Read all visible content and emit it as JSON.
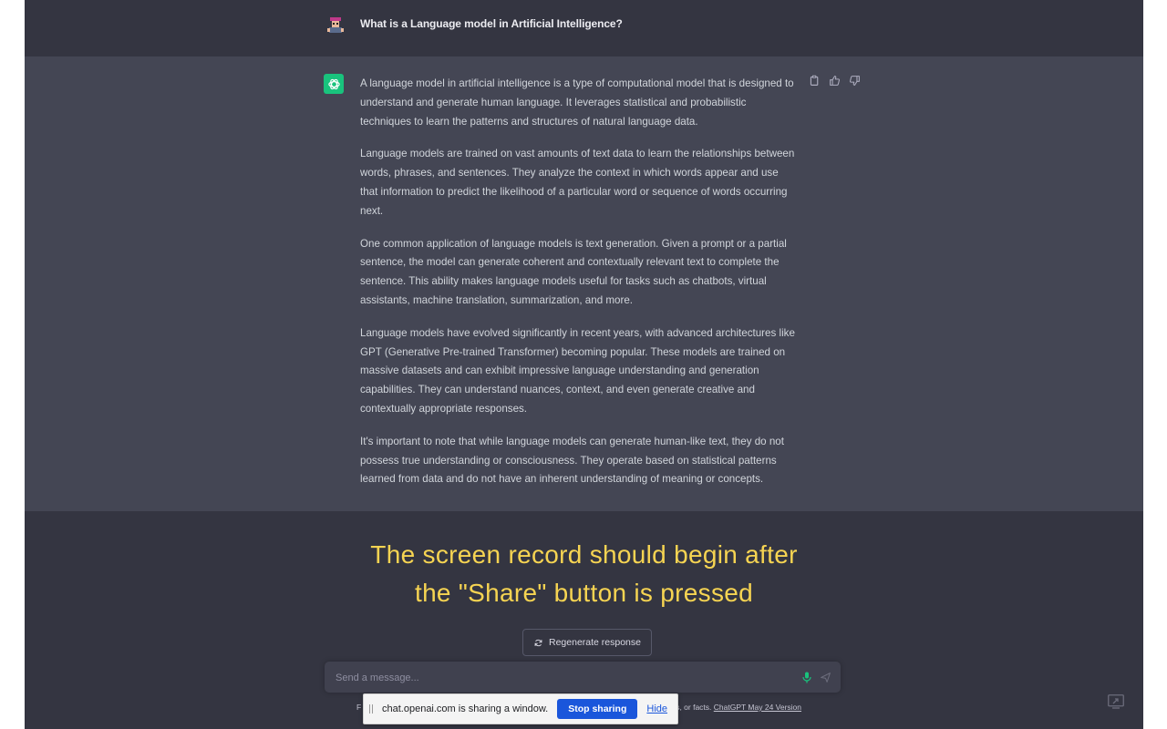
{
  "conversation": {
    "user_message": "What is a Language model in Artificial Intelligence?",
    "assistant_paragraphs": [
      "A language model in artificial intelligence is a type of computational model that is designed to understand and generate human language. It leverages statistical and probabilistic techniques to learn the patterns and structures of natural language data.",
      "Language models are trained on vast amounts of text data to learn the relationships between words, phrases, and sentences. They analyze the context in which words appear and use that information to predict the likelihood of a particular word or sequence of words occurring next.",
      "One common application of language models is text generation. Given a prompt or a partial sentence, the model can generate coherent and contextually relevant text to complete the sentence. This ability makes language models useful for tasks such as chatbots, virtual assistants, machine translation, summarization, and more.",
      "Language models have evolved significantly in recent years, with advanced architectures like GPT (Generative Pre-trained Transformer) becoming popular. These models are trained on massive datasets and can exhibit impressive language understanding and generation capabilities. They can understand nuances, context, and even generate creative and contextually appropriate responses.",
      "It's important to note that while language models can generate human-like text, they do not possess true understanding or consciousness. They operate based on statistical patterns learned from data and do not have an inherent understanding of meaning or concepts."
    ],
    "action_icons": [
      "copy-icon",
      "thumbs-up-icon",
      "thumbs-down-icon"
    ]
  },
  "overlay": {
    "caption_line1": "The screen record should begin after",
    "caption_line2": "the \"Share\" button is pressed"
  },
  "composer": {
    "regenerate_label": "Regenerate response",
    "placeholder": "Send a message...",
    "footer_left": "F",
    "footer_right": "s, or facts. ",
    "footer_link": "ChatGPT May 24 Version"
  },
  "share_bar": {
    "message": "chat.openai.com is sharing a window.",
    "stop_label": "Stop sharing",
    "hide_label": "Hide"
  },
  "colors": {
    "page_bg": "#343541",
    "assistant_bg": "#444654",
    "accent": "#19c37d",
    "caption": "#f6d452",
    "stop_button": "#1a56db"
  }
}
